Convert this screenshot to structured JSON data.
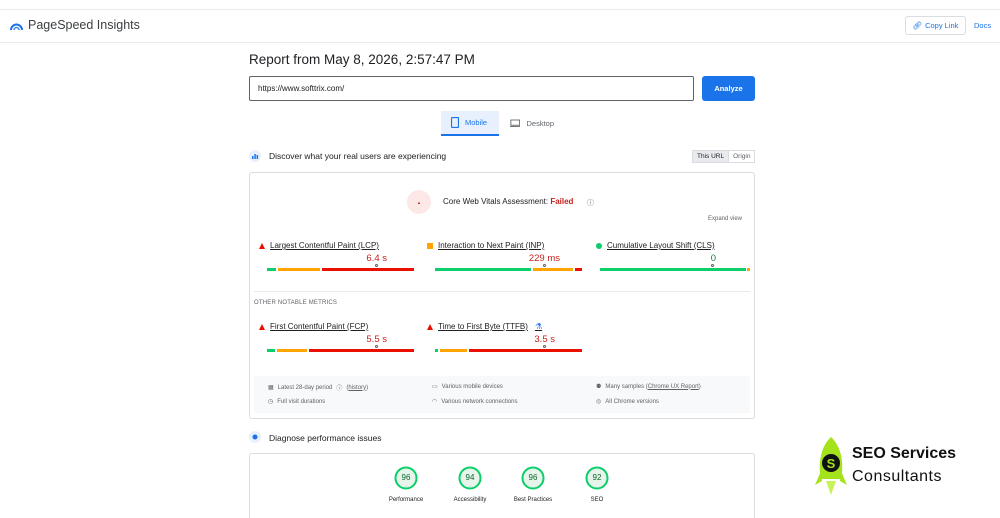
{
  "header": {
    "app_title": "PageSpeed Insights",
    "copy_link": "Copy Link",
    "docs": "Docs"
  },
  "report": {
    "title": "Report from May 8, 2026, 2:57:47 PM",
    "url_value": "https://www.softtrix.com/",
    "analyze": "Analyze"
  },
  "tabs": [
    {
      "label": "Mobile",
      "active": true
    },
    {
      "label": "Desktop",
      "active": false
    }
  ],
  "field": {
    "section_title": "Discover what your real users are experiencing",
    "toggle": [
      "This URL",
      "Origin"
    ],
    "cwv_label": "Core Web Vitals Assessment:",
    "cwv_status": "Failed",
    "expand": "Expand view",
    "other_label": "OTHER NOTABLE METRICS",
    "metrics": [
      {
        "label": "Largest Contentful Paint (LCP)",
        "value": "6.4 s",
        "status": "poor",
        "color": "#c5221f",
        "marker_frac": 0.74
      },
      {
        "label": "Interaction to Next Paint (INP)",
        "value": "229 ms",
        "status": "needs-improvement",
        "color": "#c5221f",
        "marker_frac": 0.74
      },
      {
        "label": "Cumulative Layout Shift (CLS)",
        "value": "0",
        "status": "good",
        "color": "#188038",
        "marker_frac": 0.8
      },
      {
        "label": "First Contentful Paint (FCP)",
        "value": "5.5 s",
        "status": "poor",
        "color": "#c5221f",
        "marker_frac": 0.74
      },
      {
        "label": "Time to First Byte (TTFB)",
        "value": "3.5 s",
        "status": "poor",
        "color": "#c5221f",
        "marker_frac": 0.74
      }
    ],
    "info": {
      "period": "Latest 28-day period",
      "history": "history",
      "devices": "Various mobile devices",
      "samples": "Many samples",
      "crux": "Chrome UX Report",
      "durations": "Full visit durations",
      "network": "Various network connections",
      "versions": "All Chrome versions"
    }
  },
  "lab": {
    "section_title": "Diagnose performance issues",
    "scores": [
      {
        "label": "Performance",
        "value": "96"
      },
      {
        "label": "Accessibility",
        "value": "94"
      },
      {
        "label": "Best Practices",
        "value": "96"
      },
      {
        "label": "SEO",
        "value": "92"
      }
    ]
  },
  "brand": {
    "line1": "SEO Services",
    "line2": "Consultants"
  },
  "colors": {
    "accent": "#1a73e8",
    "good": "#0cce6b",
    "average": "#ffa400",
    "poor": "#eb0f00"
  }
}
